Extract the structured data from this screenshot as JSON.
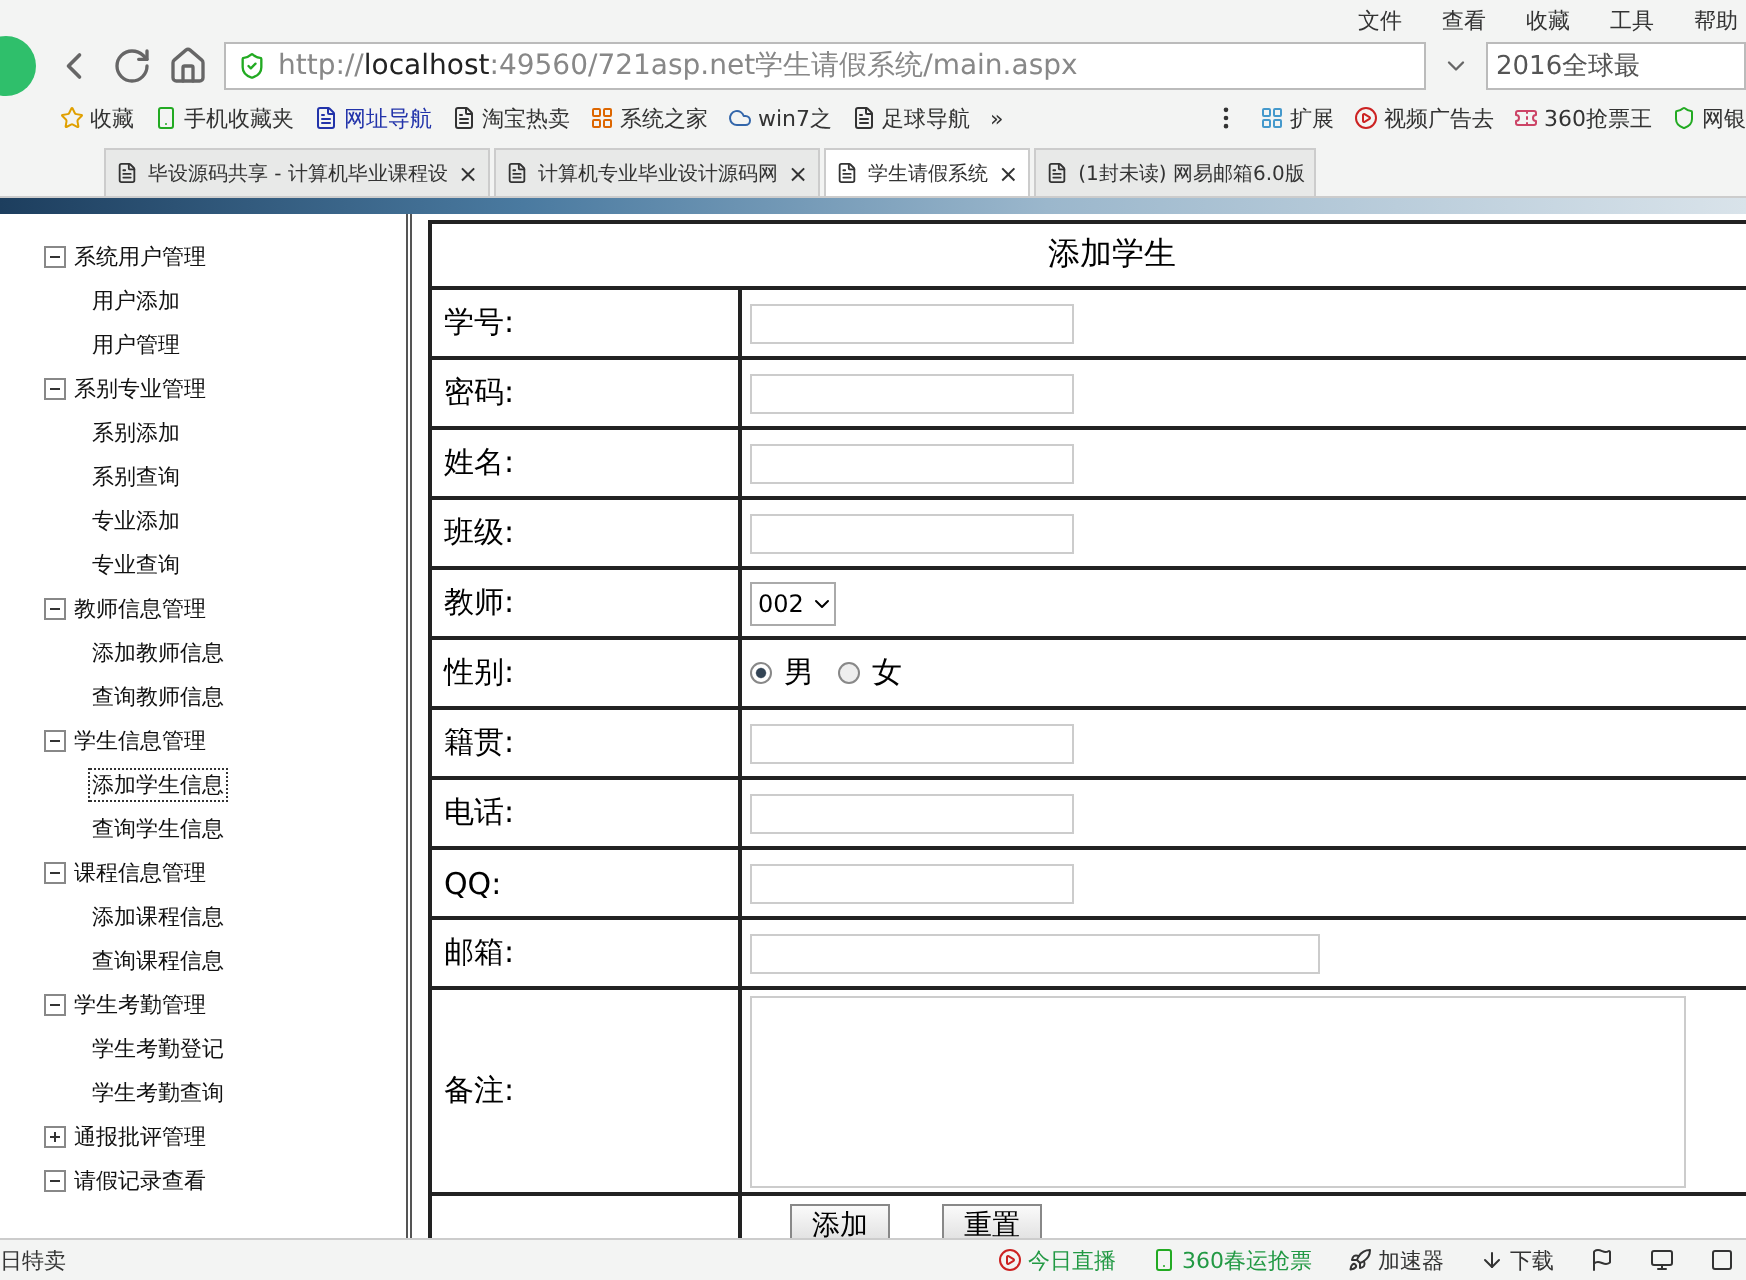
{
  "menu_bar": [
    "文件",
    "查看",
    "收藏",
    "工具",
    "帮助"
  ],
  "address_bar": {
    "scheme": "http://",
    "host": "localhost",
    "path": ":49560/721asp.net学生请假系统/main.aspx"
  },
  "search": {
    "value": "2016全球最"
  },
  "bookmarks": [
    {
      "label": "收藏",
      "kind": "star"
    },
    {
      "label": "手机收藏夹",
      "kind": "phone"
    },
    {
      "label": "网址导航",
      "kind": "page",
      "highlight": true
    },
    {
      "label": "淘宝热卖",
      "kind": "page",
      "highlight": false
    },
    {
      "label": "系统之家",
      "kind": "windows",
      "highlight": false
    },
    {
      "label": "win7之",
      "kind": "cloud",
      "highlight": false
    },
    {
      "label": "足球导航",
      "kind": "page",
      "highlight": false
    }
  ],
  "more": "»",
  "bookmarks_right": [
    {
      "label": "扩展",
      "kind": "grid"
    },
    {
      "label": "视频广告去",
      "kind": "play"
    },
    {
      "label": "360抢票王",
      "kind": "ticket"
    },
    {
      "label": "网银",
      "kind": "shield"
    }
  ],
  "tabs": [
    {
      "label": "毕设源码共享 - 计算机毕业课程设",
      "selected": false,
      "close": "×"
    },
    {
      "label": "计算机专业毕业设计源码网",
      "selected": false,
      "close": "×"
    },
    {
      "label": "学生请假系统",
      "selected": true,
      "close": "×"
    },
    {
      "label": "(1封未读) 网易邮箱6.0版",
      "selected": false
    }
  ],
  "tree": [
    {
      "label": "系统用户管理",
      "expanded": true,
      "children": [
        {
          "label": "用户添加",
          "selected": false
        },
        {
          "label": "用户管理",
          "selected": false
        }
      ]
    },
    {
      "label": "系别专业管理",
      "expanded": true,
      "children": [
        {
          "label": "系别添加",
          "selected": false
        },
        {
          "label": "系别查询",
          "selected": false
        },
        {
          "label": "专业添加",
          "selected": false
        },
        {
          "label": "专业查询",
          "selected": false
        }
      ]
    },
    {
      "label": "教师信息管理",
      "expanded": true,
      "children": [
        {
          "label": "添加教师信息",
          "selected": false
        },
        {
          "label": "查询教师信息",
          "selected": false
        }
      ]
    },
    {
      "label": "学生信息管理",
      "expanded": true,
      "children": [
        {
          "label": "添加学生信息",
          "selected": true
        },
        {
          "label": "查询学生信息",
          "selected": false
        }
      ]
    },
    {
      "label": "课程信息管理",
      "expanded": true,
      "children": [
        {
          "label": "添加课程信息",
          "selected": false
        },
        {
          "label": "查询课程信息",
          "selected": false
        }
      ]
    },
    {
      "label": "学生考勤管理",
      "expanded": true,
      "children": [
        {
          "label": "学生考勤登记",
          "selected": false
        },
        {
          "label": "学生考勤查询",
          "selected": false
        }
      ]
    },
    {
      "label": "通报批评管理",
      "expanded": false
    },
    {
      "label": "请假记录查看",
      "expanded": true
    }
  ],
  "form": {
    "title": "添加学生",
    "rows": [
      {
        "label": "学号:",
        "kind": "text"
      },
      {
        "label": "密码:",
        "kind": "text"
      },
      {
        "label": "姓名:",
        "kind": "text"
      },
      {
        "label": "班级:",
        "kind": "text"
      },
      {
        "label": "教师:",
        "kind": "select",
        "value": "002"
      },
      {
        "label": "性别:",
        "kind": "radio",
        "options": [
          {
            "label": "男",
            "selected": true
          },
          {
            "label": "女",
            "selected": false
          }
        ]
      },
      {
        "label": "籍贯:",
        "kind": "text"
      },
      {
        "label": "电话:",
        "kind": "text"
      },
      {
        "label": "QQ:",
        "kind": "text"
      },
      {
        "label": "邮箱:",
        "kind": "wide"
      },
      {
        "label": "备注:",
        "kind": "textarea"
      }
    ],
    "buttons": [
      "添加",
      "重置"
    ]
  },
  "status_bar": {
    "left": "日特卖",
    "items": [
      {
        "label": "今日直播",
        "kind": "play"
      },
      {
        "label": "360春运抢票",
        "kind": "phone"
      },
      {
        "label": "加速器",
        "kind": "rocket"
      },
      {
        "label": "下载",
        "kind": "download"
      }
    ]
  }
}
